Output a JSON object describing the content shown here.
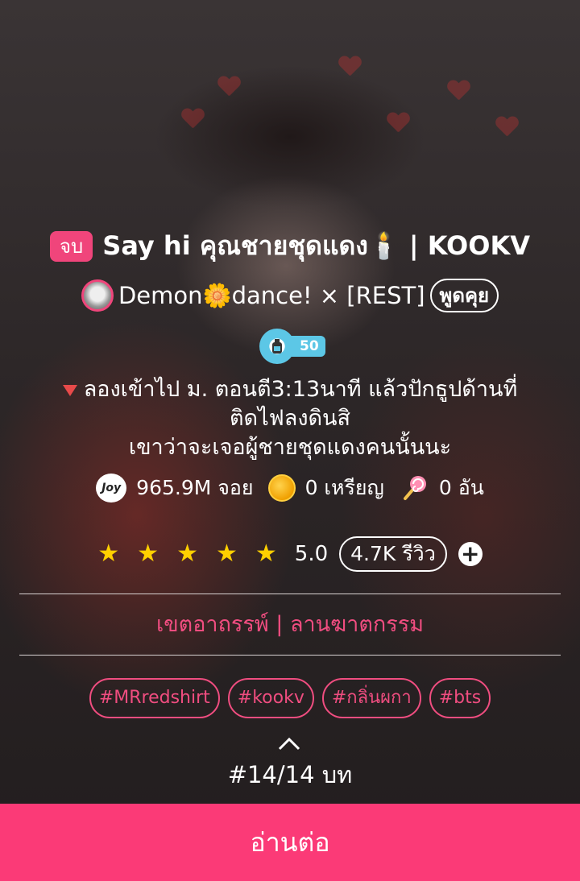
{
  "story": {
    "status_badge": "จบ",
    "title": "Say hi คุณชายชุดแดง🕯️ | KOOKV"
  },
  "author": {
    "name": "Demon🌼dance! × [REST]",
    "chat_label": "พูดคุย"
  },
  "level": {
    "value": "50"
  },
  "description": {
    "line1": "ลองเข้าไป ม. ตอนตี3:13นาที แล้วปักธูปด้านที่",
    "line2": "ติดไฟลงดินสิ",
    "line3": "เขาว่าจะเจอผู้ชายชุดแดงคนนั้นนะ"
  },
  "stats": {
    "joy_icon_text": "Joy",
    "joy": "965.9M จอย",
    "coins": "0 เหรียญ",
    "candy": "0 อัน"
  },
  "rating": {
    "stars": 5,
    "value": "5.0",
    "reviews": "4.7K รีวิว"
  },
  "category": "เขตอาถรรพ์ | ลานฆาตกรรม",
  "tags": [
    "#MRredshirt",
    "#kookv",
    "#กลิ่นผกา",
    "#bts"
  ],
  "chapter": "#14/14 บท",
  "read_button": "อ่านต่อ",
  "colors": {
    "accent_pink": "#fb3a77",
    "tag_pink": "#f04d80",
    "star_yellow": "#ffd000",
    "level_blue": "#5cc7e6"
  },
  "icons": {
    "joy": "joy-bubble-icon",
    "coin": "coin-icon",
    "candy": "lollipop-icon",
    "star": "star-icon",
    "plus": "plus-circle-icon",
    "chevron": "chevron-up-icon",
    "level": "bottle-icon"
  }
}
